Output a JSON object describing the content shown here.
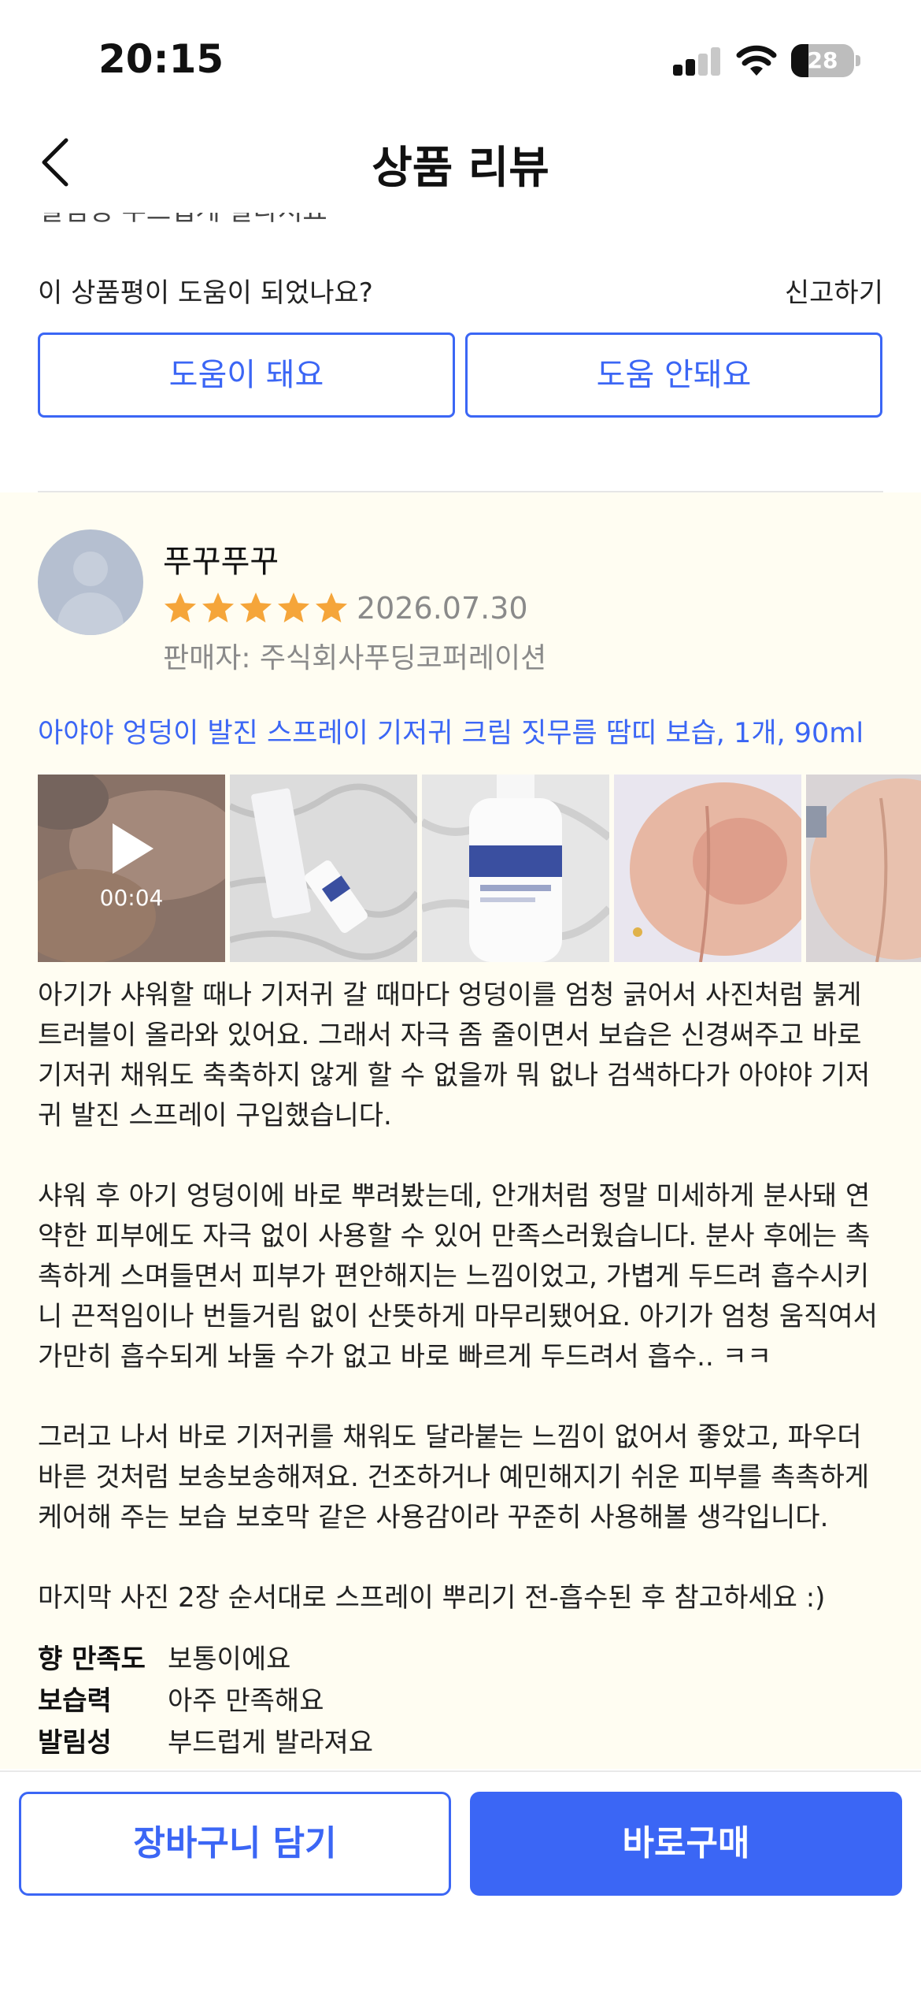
{
  "status_bar": {
    "time": "20:15",
    "battery": "28",
    "battery_level": 0.28
  },
  "nav": {
    "title": "상품 리뷰",
    "back_icon": "chevron-left-icon"
  },
  "previous_review": {
    "cut_text": "발림성      부드럽게 발라져요",
    "helpful_question": "이 상품평이 도움이 되었나요?",
    "report": "신고하기",
    "helpful_yes": "도움이 돼요",
    "helpful_no": "도움 안돼요"
  },
  "review": {
    "reviewer": "푸꾸푸꾸",
    "rating": 5,
    "date": "2026.07.30",
    "seller": "판매자: 주식회사푸딩코퍼레이션",
    "product": "아야야 엉덩이 발진 스프레이 기저귀 크림 짓무름 땀띠 보습, 1개, 90ml",
    "video_duration": "00:04",
    "photos": [
      "video-thumbnail",
      "product-box-photo",
      "product-bottle-photo",
      "before-photo",
      "after-photo"
    ],
    "paragraphs": [
      "아기가 샤워할 때나 기저귀 갈 때마다 엉덩이를 엄청 긁어서 사진처럼 붉게 트러블이 올라와 있어요. 그래서 자극 좀 줄이면서 보습은 신경써주고 바로 기저귀 채워도 축축하지 않게 할 수 없을까 뭐 없나 검색하다가 아야야 기저귀 발진 스프레이 구입했습니다.",
      "샤워 후 아기 엉덩이에 바로 뿌려봤는데, 안개처럼 정말 미세하게 분사돼 연약한 피부에도 자극 없이 사용할 수 있어 만족스러웠습니다. 분사 후에는 촉촉하게 스며들면서 피부가 편안해지는 느낌이었고, 가볍게 두드려 흡수시키니 끈적임이나 번들거림 없이 산뜻하게 마무리됐어요. 아기가 엄청 움직여서 가만히 흡수되게 놔둘 수가 없고 바로 빠르게 두드려서 흡수.. ㅋㅋ",
      "그러고 나서 바로 기저귀를 채워도 달라붙는 느낌이 없어서 좋았고, 파우더 바른 것처럼 보송보송해져요. 건조하거나 예민해지기 쉬운 피부를 촉촉하게 케어해 주는 보습 보호막 같은 사용감이라 꾸준히 사용해볼 생각입니다.",
      "마지막 사진 2장 순서대로 스프레이 뿌리기 전-흡수된 후 참고하세요 :)"
    ],
    "attributes": [
      {
        "key": "향 만족도",
        "value": "보통이에요"
      },
      {
        "key": "보습력",
        "value": "아주 만족해요"
      },
      {
        "key": "발림성",
        "value": "부드럽게 발라져요"
      }
    ]
  },
  "bottom_bar": {
    "cart": "장바구니 담기",
    "buy": "바로구매"
  },
  "colors": {
    "accent": "#3b66f5",
    "star": "#f5a53a",
    "review_bg": "#fffdf2"
  }
}
